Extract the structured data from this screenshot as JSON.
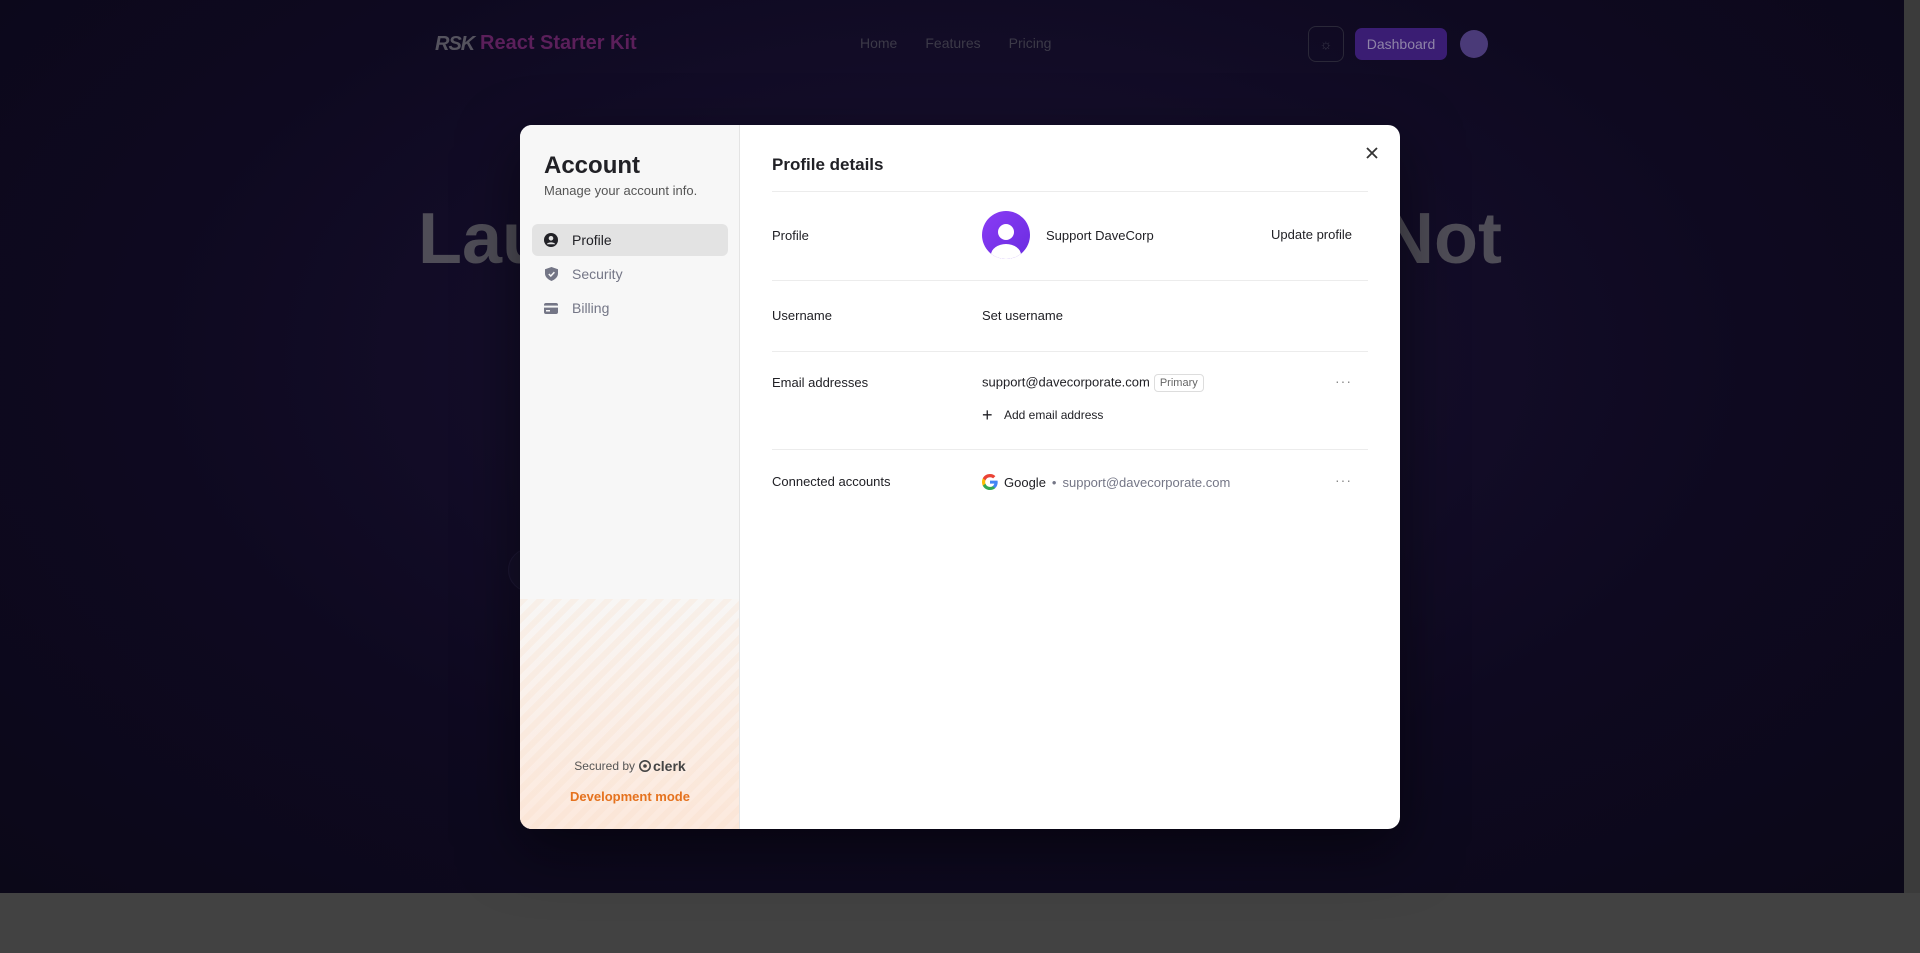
{
  "background": {
    "logo": "RSK",
    "brand": "React Starter Kit",
    "nav_links": [
      "Home",
      "Features",
      "Pricing"
    ],
    "dashboard_label": "Dashboard",
    "hero_left": "Lau",
    "hero_right": "Not"
  },
  "sidebar": {
    "title": "Account",
    "subtitle": "Manage your account info.",
    "items": [
      {
        "label": "Profile",
        "icon": "user-circle-icon",
        "active": true
      },
      {
        "label": "Security",
        "icon": "shield-icon",
        "active": false
      },
      {
        "label": "Billing",
        "icon": "credit-card-icon",
        "active": false
      }
    ],
    "secured_by": "Secured by",
    "clerk_label": "clerk",
    "dev_mode": "Development mode"
  },
  "main": {
    "title": "Profile details",
    "profile": {
      "label": "Profile",
      "name": "Support DaveCorp",
      "update_label": "Update profile"
    },
    "username": {
      "label": "Username",
      "value": "Set username"
    },
    "emails": {
      "label": "Email addresses",
      "primary_email": "support@davecorporate.com",
      "badge": "Primary",
      "add_label": "Add email address"
    },
    "connected": {
      "label": "Connected accounts",
      "provider": "Google",
      "separator": "•",
      "email": "support@davecorporate.com"
    }
  },
  "colors": {
    "accent": "#e5721e",
    "avatar": "#7a34ea",
    "overlay_bg": "#0f0a1f"
  }
}
